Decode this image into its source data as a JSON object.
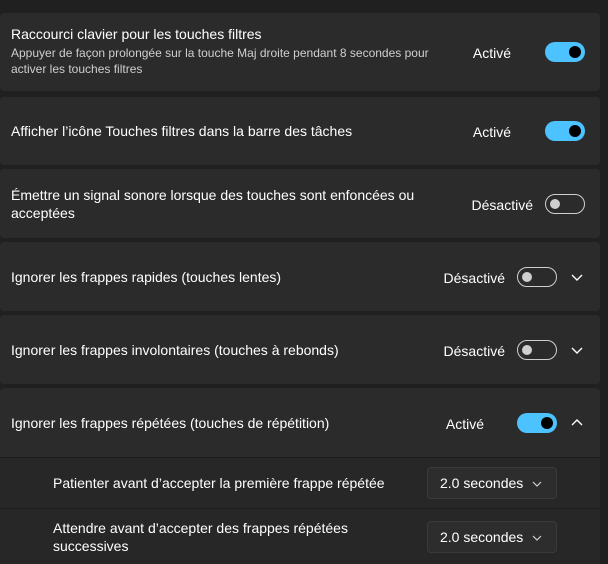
{
  "settings": [
    {
      "title": "Raccourci clavier pour les touches filtres",
      "description": "Appuyer de façon prolongée sur la touche Maj droite pendant 8 secondes pour activer les touches filtres",
      "state": "Activé"
    },
    {
      "title": "Afficher l’icône Touches filtres dans la barre des tâches",
      "state": "Activé"
    },
    {
      "title": "Émettre un signal sonore lorsque des touches sont enfoncées ou acceptées",
      "state": "Désactivé"
    },
    {
      "title": "Ignorer les frappes rapides (touches lentes)",
      "state": "Désactivé"
    },
    {
      "title": "Ignorer les frappes involontaires (touches à rebonds)",
      "state": "Désactivé"
    },
    {
      "title": "Ignorer les frappes répétées (touches de répétition)",
      "state": "Activé"
    }
  ],
  "repeat_options": [
    {
      "label": "Patienter avant d’accepter la première frappe répétée",
      "value": "2.0 secondes"
    },
    {
      "label": "Attendre avant d’accepter des frappes répétées successives",
      "value": "2.0 secondes"
    }
  ],
  "colors": {
    "accent": "#4cc2ff",
    "background": "#202020",
    "card": "#2b2b2b"
  },
  "icons": {
    "expand": "chevron-down-icon",
    "collapse": "chevron-up-icon",
    "select": "chevron-down-icon"
  }
}
